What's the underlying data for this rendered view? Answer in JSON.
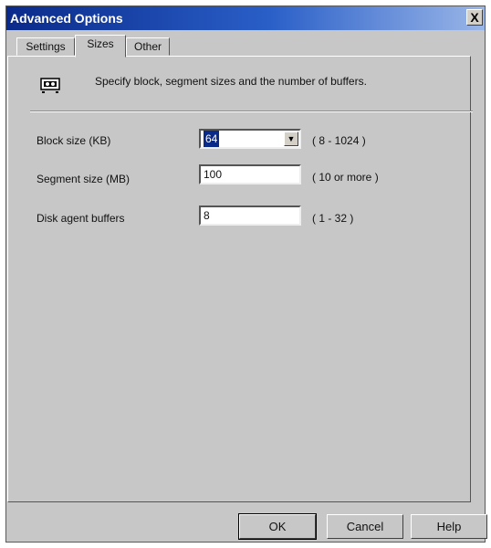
{
  "window": {
    "title": "Advanced Options",
    "close_label": "X"
  },
  "tabs": [
    {
      "label": "Settings",
      "active": false
    },
    {
      "label": "Sizes",
      "active": true
    },
    {
      "label": "Other",
      "active": false
    }
  ],
  "description": "Specify block, segment sizes and the number of buffers.",
  "fields": {
    "block_size": {
      "label": "Block size (KB)",
      "value": "64",
      "range": "( 8 - 1024 )"
    },
    "segment_size": {
      "label": "Segment size (MB)",
      "value": "100",
      "range": "( 10 or more )"
    },
    "disk_agent_buffers": {
      "label": "Disk agent buffers",
      "value": "8",
      "range": "( 1 - 32 )"
    }
  },
  "buttons": {
    "ok": "OK",
    "cancel": "Cancel",
    "help": "Help"
  },
  "colors": {
    "titlebar": "#0a2a8a",
    "dialog_bg": "#c7c7c7",
    "selection": "#0a2a8a"
  }
}
